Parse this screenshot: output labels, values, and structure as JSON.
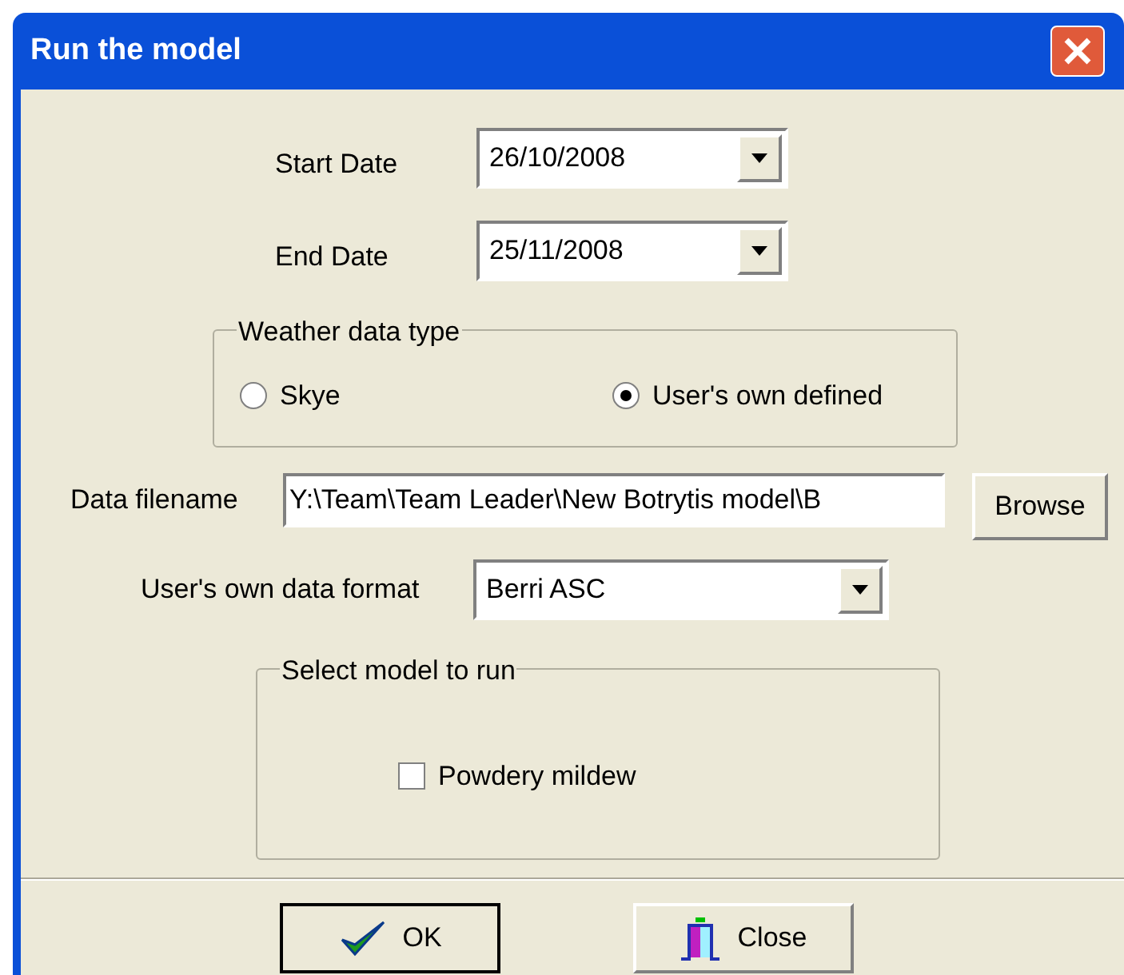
{
  "window": {
    "title": "Run the model"
  },
  "start_date": {
    "label": "Start Date",
    "value": "26/10/2008"
  },
  "end_date": {
    "label": "End Date",
    "value": "25/11/2008"
  },
  "weather_data_type": {
    "legend": "Weather data type",
    "options": [
      {
        "label": "Skye",
        "selected": false
      },
      {
        "label": "User's own defined",
        "selected": true
      }
    ]
  },
  "data_filename": {
    "label": "Data filename",
    "value": "Y:\\Team\\Team Leader\\New Botrytis model\\B",
    "button": "Browse"
  },
  "data_format": {
    "label": "User's own data format",
    "value": "Berri ASC"
  },
  "select_model": {
    "legend": "Select model to run",
    "options": [
      {
        "label": "Powdery mildew",
        "checked": false
      }
    ]
  },
  "buttons": [
    {
      "kind": "ok",
      "label": "OK"
    },
    {
      "kind": "close",
      "label": "Close"
    }
  ]
}
